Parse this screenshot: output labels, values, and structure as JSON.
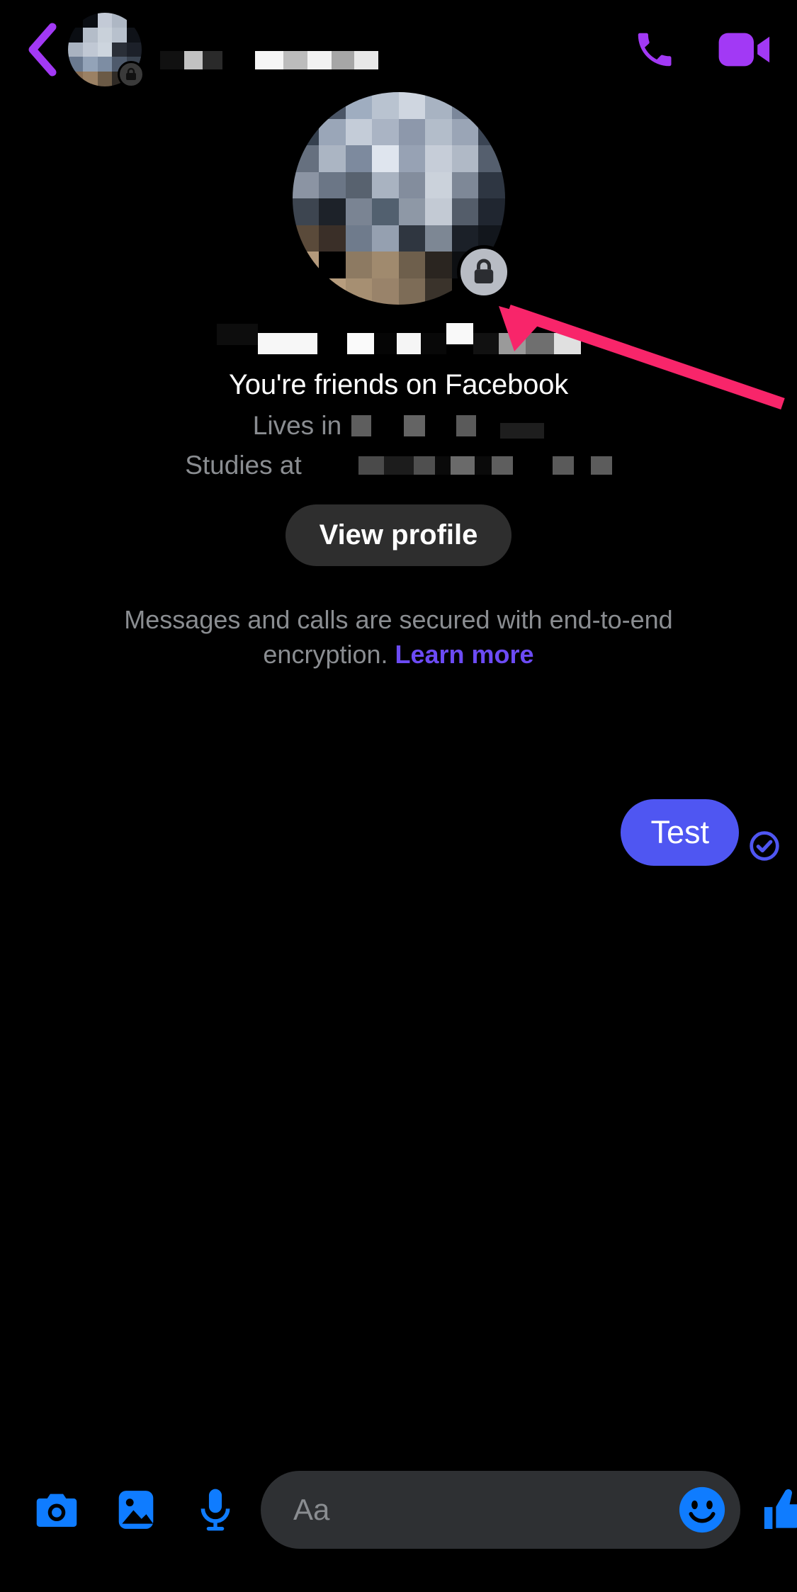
{
  "theme": {
    "background": "#000000",
    "header_icon_purple": "#A239F5",
    "toolbar_blue": "#0F7CFF",
    "bubble_blue": "#4F56F2",
    "link_purple": "#6C4BF4",
    "muted_text": "#8a8d91",
    "pill_bg": "#2e2e2e",
    "composer_bg": "#2e3033",
    "arrow_pink": "#F8256A",
    "lock_badge_bg": "#b8bcc4"
  },
  "header": {
    "back_icon": "chevron-left-icon",
    "avatar_alt": "contact-avatar",
    "avatar_lock_icon": "lock-icon",
    "contact_name_redacted": true,
    "contact_name": "",
    "audio_call_icon": "phone-icon",
    "video_call_icon": "video-camera-icon"
  },
  "profile": {
    "avatar_alt": "contact-large-avatar",
    "avatar_lock_icon": "lock-icon",
    "name_redacted": true,
    "name": "",
    "relationship": "You're friends on Facebook",
    "details": [
      {
        "label": "Lives in",
        "value_redacted": true,
        "value": ""
      },
      {
        "label": "Studies at",
        "value_redacted": true,
        "value": ""
      }
    ],
    "view_profile_label": "View profile"
  },
  "encryption_notice": {
    "text": "Messages and calls are secured with end-to-end encryption. ",
    "link_label": "Learn more"
  },
  "messages": [
    {
      "text": "Test",
      "sender": "me",
      "status_icon": "check-circle-icon",
      "status": "delivered"
    }
  ],
  "annotation": {
    "type": "arrow",
    "color": "#F8256A",
    "points_to": "profile-avatar-lock-badge"
  },
  "composer": {
    "camera_icon": "camera-icon",
    "gallery_icon": "image-icon",
    "mic_icon": "microphone-icon",
    "input_value": "",
    "input_placeholder": "Aa",
    "emoji_icon": "smiley-icon",
    "like_icon": "thumbs-up-icon"
  }
}
